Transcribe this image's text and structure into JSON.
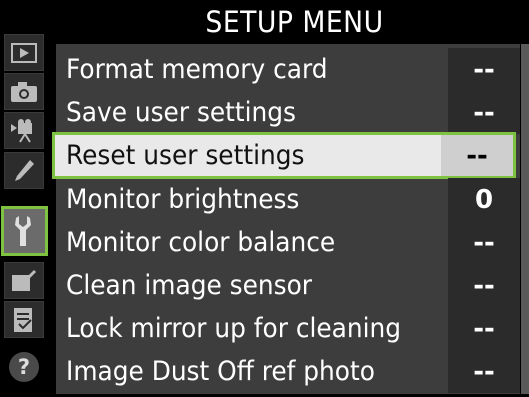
{
  "header": {
    "title": "SETUP MENU"
  },
  "sidebar": {
    "tabs": [
      {
        "name": "playback-tab-icon"
      },
      {
        "name": "camera-tab-icon"
      },
      {
        "name": "movie-tab-icon"
      },
      {
        "name": "pencil-tab-icon"
      },
      {
        "name": "wrench-tab-icon",
        "active": true
      },
      {
        "name": "retouch-tab-icon"
      },
      {
        "name": "my-menu-tab-icon"
      }
    ],
    "help_label": "?"
  },
  "menu": {
    "items": [
      {
        "label": "Format memory card",
        "value": "--"
      },
      {
        "label": "Save user settings",
        "value": "--"
      },
      {
        "label": "Reset user settings",
        "value": "--",
        "selected": true
      },
      {
        "label": "Monitor brightness",
        "value": "0"
      },
      {
        "label": "Monitor color balance",
        "value": "--"
      },
      {
        "label": "Clean image sensor",
        "value": "--"
      },
      {
        "label": "Lock mirror up for cleaning",
        "value": "--"
      },
      {
        "label": "Image Dust Off ref photo",
        "value": "--"
      }
    ]
  },
  "colors": {
    "highlight_border": "#7dc241",
    "selected_row": "#e9e9e9",
    "menu_bg": "#3d3d3d"
  }
}
